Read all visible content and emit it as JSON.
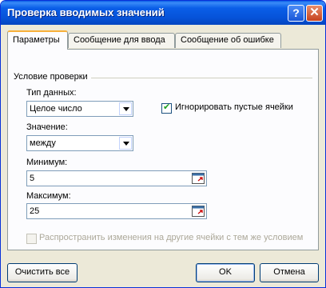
{
  "window": {
    "title": "Проверка вводимых значений",
    "help_symbol": "?",
    "close_symbol": "✕"
  },
  "tabs": [
    {
      "label": "Параметры",
      "active": true
    },
    {
      "label": "Сообщение для ввода",
      "active": false
    },
    {
      "label": "Сообщение об ошибке",
      "active": false
    }
  ],
  "group": {
    "label": "Условие проверки"
  },
  "data_type": {
    "label": "Тип данных:",
    "value": "Целое число"
  },
  "ignore_blank": {
    "label": "Игнорировать пустые ячейки",
    "checked": true
  },
  "condition": {
    "label": "Значение:",
    "value": "между"
  },
  "minimum": {
    "label": "Минимум:",
    "value": "5"
  },
  "maximum": {
    "label": "Максимум:",
    "value": "25"
  },
  "apply_all": {
    "label": "Распространить изменения на другие ячейки с тем же условием",
    "checked": false,
    "enabled": false
  },
  "buttons": {
    "clear_all": "Очистить все",
    "ok": "OK",
    "cancel": "Отмена"
  },
  "icons": {
    "help": "help-icon",
    "close": "close-icon",
    "dropdown": "chevron-down-icon",
    "range": "collapse-dialog-icon"
  },
  "colors": {
    "title_bar": "#0a5de6",
    "dialog_bg": "#ece9d8",
    "tab_highlight": "#f7b03a"
  }
}
